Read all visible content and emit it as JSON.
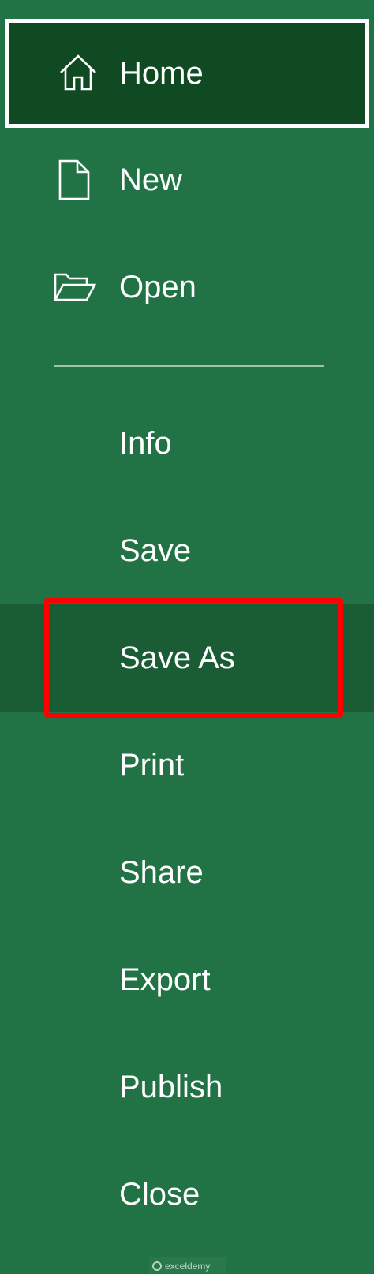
{
  "backstage": {
    "items": [
      {
        "key": "home",
        "label": "Home",
        "icon": "home-icon",
        "selected": true
      },
      {
        "key": "new",
        "label": "New",
        "icon": "new-document-icon"
      },
      {
        "key": "open",
        "label": "Open",
        "icon": "open-folder-icon"
      },
      {
        "key": "info",
        "label": "Info"
      },
      {
        "key": "save",
        "label": "Save"
      },
      {
        "key": "save_as",
        "label": "Save As",
        "highlighted": true
      },
      {
        "key": "print",
        "label": "Print"
      },
      {
        "key": "share",
        "label": "Share"
      },
      {
        "key": "export",
        "label": "Export"
      },
      {
        "key": "publish",
        "label": "Publish"
      },
      {
        "key": "close",
        "label": "Close"
      }
    ]
  },
  "watermark": {
    "text": "exceldemy"
  },
  "colors": {
    "background": "#217346",
    "selected": "#0f4a22",
    "hover": "#1a5d35",
    "highlight_border": "#ff0000",
    "text": "#ffffff"
  }
}
